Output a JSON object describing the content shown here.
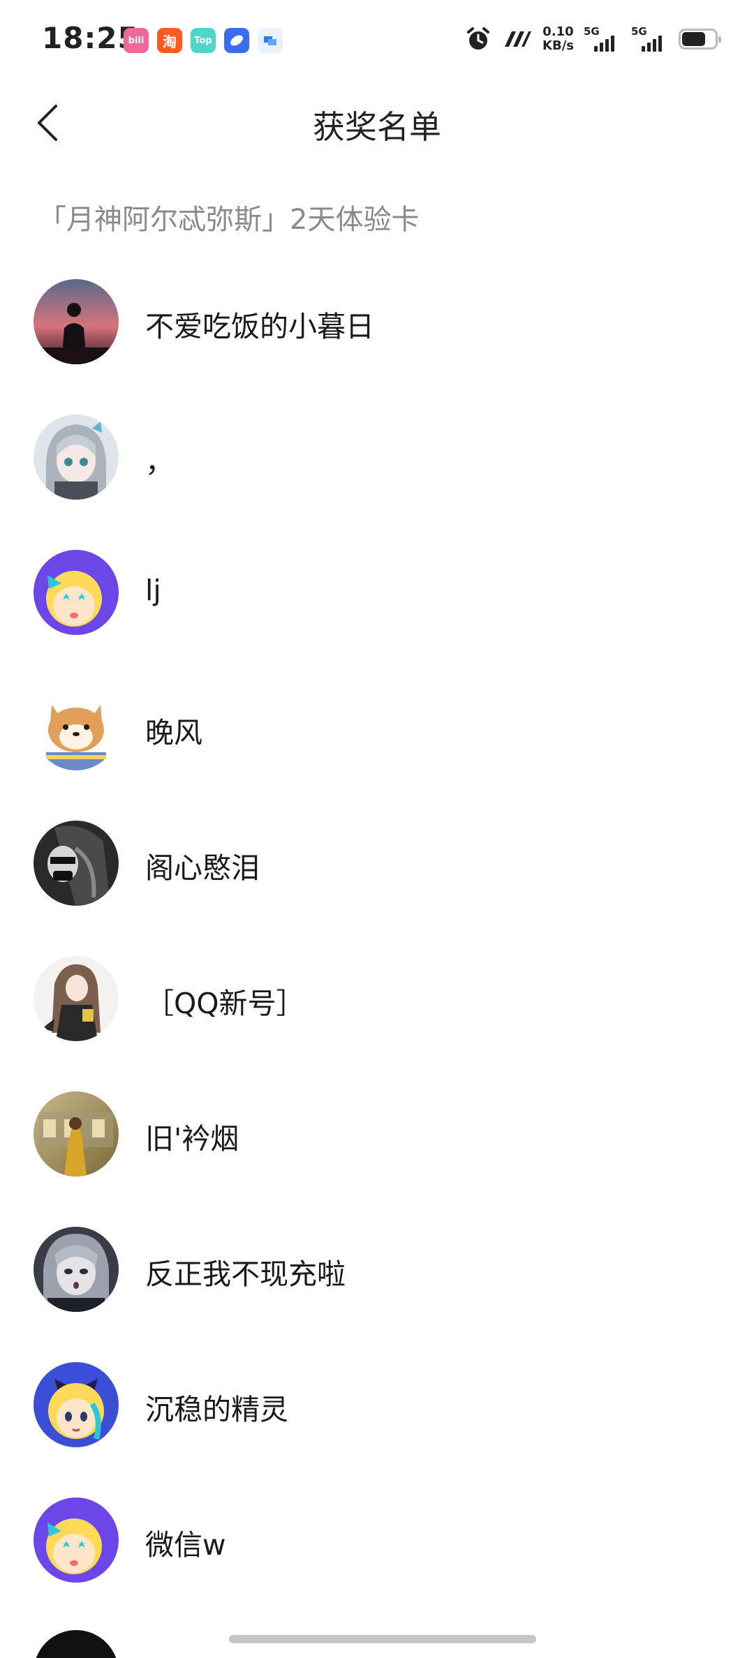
{
  "status_bar": {
    "time": "18:25",
    "app_icons": [
      {
        "name": "bilibili",
        "label": "bili",
        "color": "#f0679a"
      },
      {
        "name": "taobao",
        "label": "淘",
        "color": "#ff5a1f"
      },
      {
        "name": "top",
        "label": "Top",
        "color": "#4fd6c8"
      },
      {
        "name": "blue-app",
        "label": "",
        "color": "#3a6cf0"
      },
      {
        "name": "chat-app",
        "label": "",
        "color": "#e8f2ff"
      }
    ],
    "net_speed_value": "0.10",
    "net_speed_unit": "KB/s",
    "signal_1_label": "5G",
    "signal_2_label": "5G"
  },
  "nav": {
    "title": "获奖名单"
  },
  "section": {
    "title": "「月神阿尔忒弥斯」2天体验卡"
  },
  "winners": [
    {
      "name": "不爱吃饭的小暮日",
      "avatar": "sunset-silhouette"
    },
    {
      "name": "，",
      "avatar": "silver-hair-anime"
    },
    {
      "name": "lj",
      "avatar": "star-mascot"
    },
    {
      "name": "晚风",
      "avatar": "shiba-dog"
    },
    {
      "name": "阁心愍泪",
      "avatar": "dark-anime"
    },
    {
      "name": "［QQ新号］",
      "avatar": "brown-hair-anime"
    },
    {
      "name": "旧'衿烟",
      "avatar": "autumn-photo"
    },
    {
      "name": "反正我不现充啦",
      "avatar": "grey-hair-anime"
    },
    {
      "name": "沉稳的精灵",
      "avatar": "cute-mascot"
    },
    {
      "name": "微信w",
      "avatar": "star-mascot"
    }
  ]
}
